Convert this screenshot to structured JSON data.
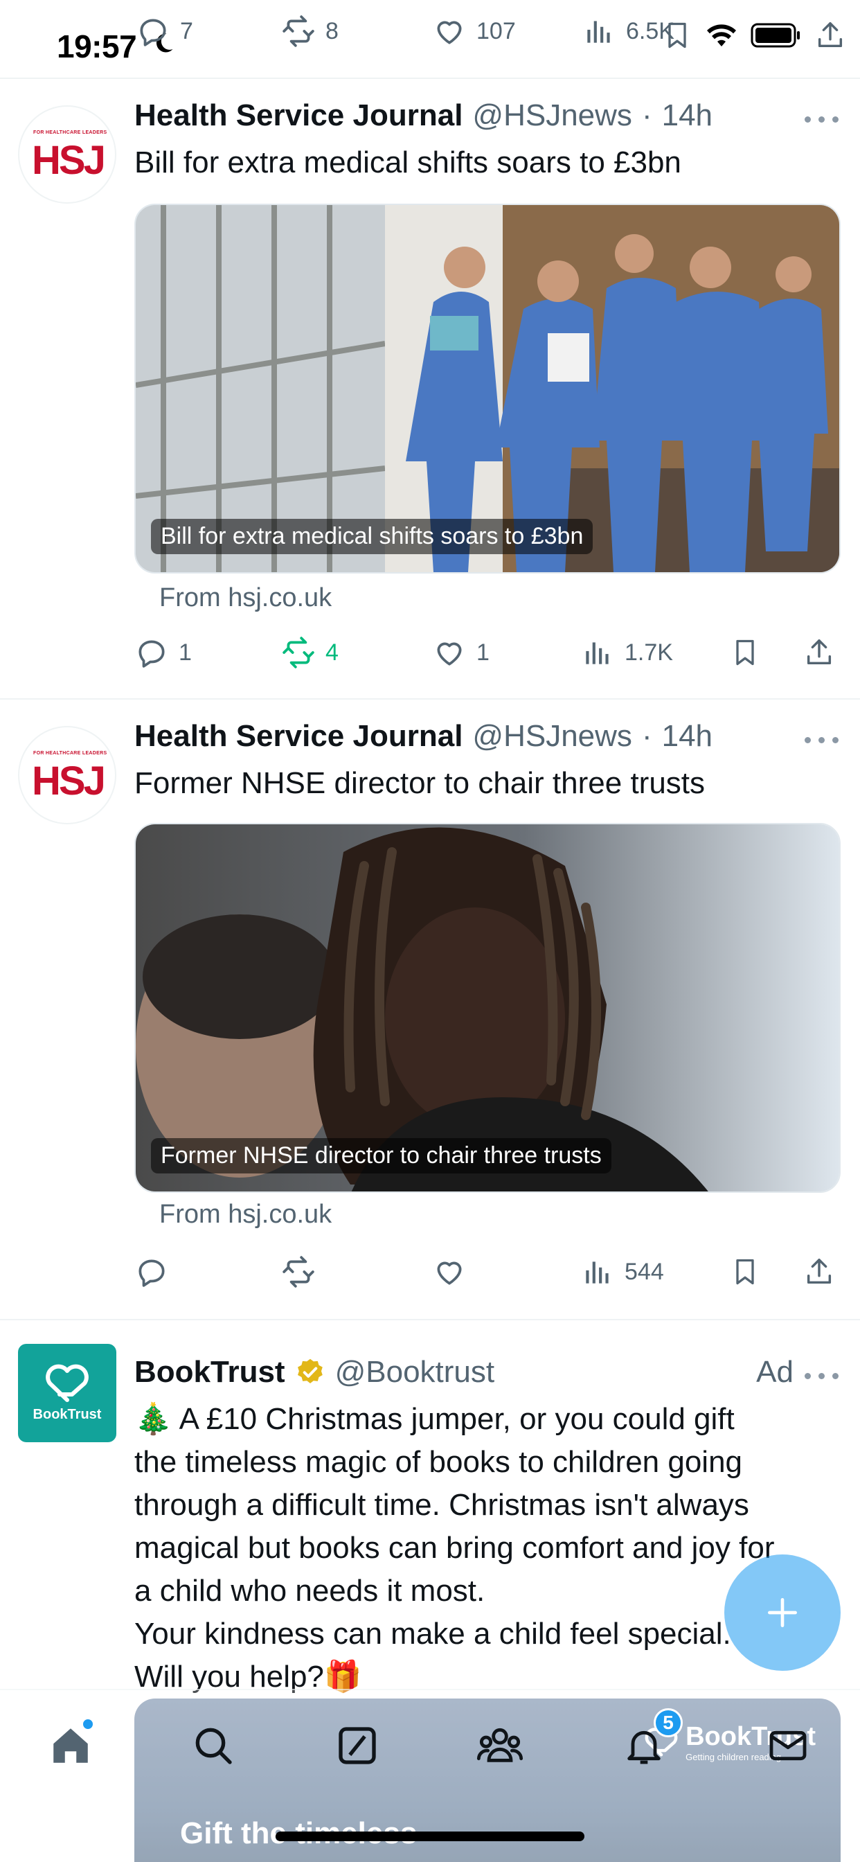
{
  "status_bar": {
    "time": "19:57",
    "top_actions": {
      "reply_count": "7",
      "repost_count": "8",
      "like_count": "107",
      "views_count": "6.5K"
    }
  },
  "tweets": [
    {
      "display_name": "Health Service Journal",
      "handle": "@HSJnews",
      "separator": "·",
      "time": "14h",
      "avatar_text_small": "FOR HEALTHCARE LEADERS",
      "avatar_text_big": "HSJ",
      "text": "Bill for extra medical shifts soars to £3bn",
      "card_caption": "Bill for extra medical shifts soars to £3bn",
      "card_source": "From hsj.co.uk",
      "reply_count": "1",
      "repost_count": "4",
      "like_count": "1",
      "views_count": "1.7K"
    },
    {
      "display_name": "Health Service Journal",
      "handle": "@HSJnews",
      "separator": "·",
      "time": "14h",
      "avatar_text_small": "FOR HEALTHCARE LEADERS",
      "avatar_text_big": "HSJ",
      "text": "Former NHSE director to chair three trusts",
      "card_caption": "Former NHSE director to chair three trusts",
      "card_source": "From hsj.co.uk",
      "reply_count": "",
      "repost_count": "",
      "like_count": "",
      "views_count": "544"
    }
  ],
  "ad": {
    "display_name": "BookTrust",
    "handle": "@Booktrust",
    "ad_label": "Ad",
    "avatar_label": "BookTrust",
    "lines": [
      "🎄 A £10 Christmas jumper, or you could gift",
      "the timeless magic of books to children going",
      "through a difficult time. Christmas isn't always",
      "magical but books can bring comfort and joy for",
      "a child who needs it most.",
      "Your kindness can make a child feel special.",
      "Will you help?🎁"
    ],
    "media_title": "Gift the timeless",
    "media_brand": "BookTrust",
    "media_tagline": "Getting children reading"
  },
  "bottom_nav": {
    "notifications_badge": "5"
  },
  "colors": {
    "accent": "#1d9bf0",
    "repost_active": "#00ba7c",
    "muted": "#536471",
    "booktrust": "#12a39a",
    "hsj_red": "#c8102e"
  }
}
